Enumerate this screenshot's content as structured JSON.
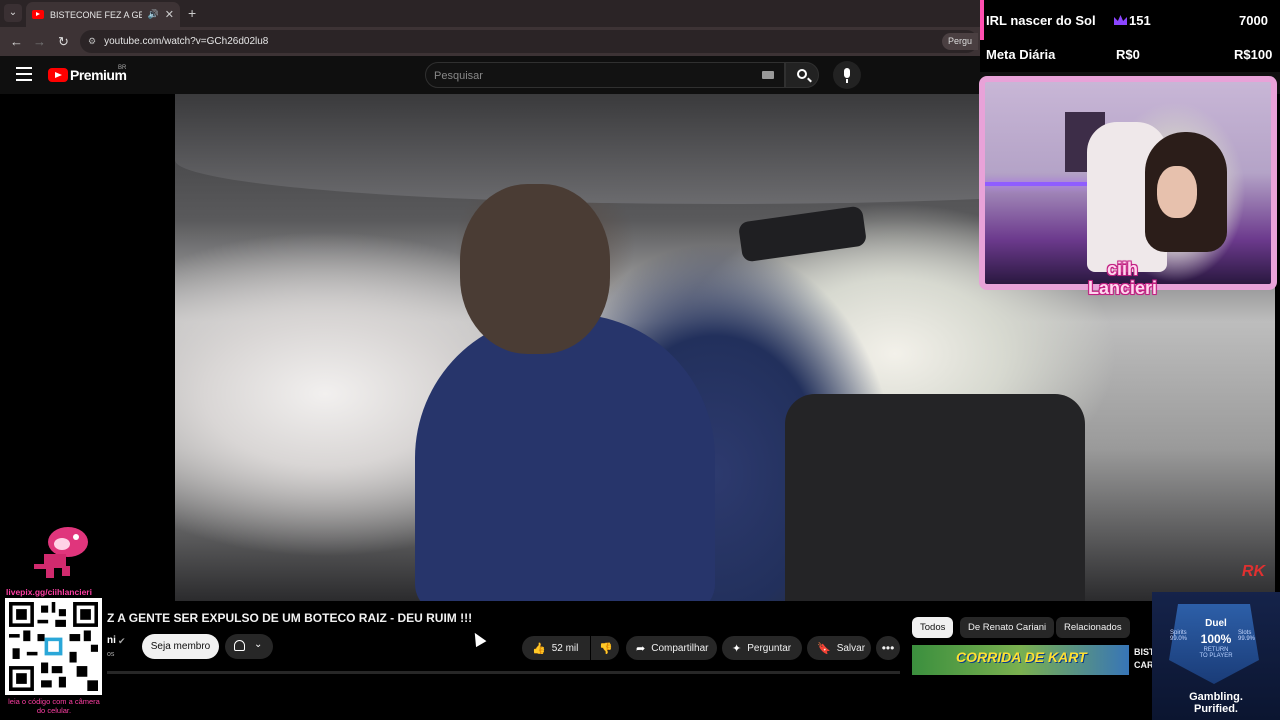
{
  "browser": {
    "tab_title": "BISTECONE FEZ A GENTE SER EXPULSO DE UM BOTECO RAIZ - DEU RUIM !!!",
    "url": "youtube.com/watch?v=GCh26d02lu8",
    "ask_chip": "Pergu"
  },
  "youtube": {
    "brand": "Premium",
    "country": "BR",
    "search_placeholder": "Pesquisar"
  },
  "video": {
    "title": "Z A GENTE SER EXPULSO DE UM BOTECO RAIZ - DEU RUIM !!!",
    "channel": "ni",
    "subs": "os",
    "watermark": "RK",
    "member_label": "Seja membro",
    "likes": "52 mil",
    "share_label": "Compartilhar",
    "ask_label": "Perguntar",
    "save_label": "Salvar"
  },
  "sidebar": {
    "chips": [
      "Todos",
      "De Renato Cariani",
      "Relacionados"
    ],
    "rec_thumb_text": "CORRIDA DE KART",
    "rec_title_lines": [
      "BIST",
      "CAR"
    ]
  },
  "overlay": {
    "goal1_label": "IRL nascer do Sol",
    "goal1_count": "151",
    "goal1_target": "7000",
    "goal2_label": "Meta Diária",
    "goal2_current": "R$0",
    "goal2_target": "R$100",
    "streamer_line1": "ciih",
    "streamer_line2": "Lancieri",
    "pix_url": "livepix.gg/ciihlancieri",
    "qr_caption": "leia o código com a câmera do celular."
  },
  "ad": {
    "title": "Duel",
    "percent": "100%",
    "rtp_line1": "RETURN",
    "rtp_line2": "TO PLAYER",
    "left_label": "Spirits",
    "left_value": "99.0%",
    "right_label": "Slots",
    "right_value": "99.9%",
    "tagline_1": "Gambling.",
    "tagline_2": "Purified."
  },
  "colors": {
    "youtube_red": "#ff0000",
    "overlay_pink": "#ff3fa4",
    "webcam_border": "#e8a2d8",
    "crown_purple": "#8b45ff"
  }
}
